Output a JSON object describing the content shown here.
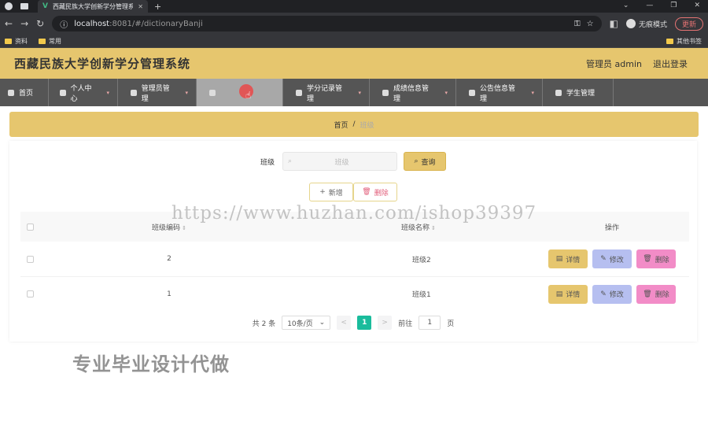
{
  "browser": {
    "tab_title": "西藏民族大学创新学分管理系统",
    "url_host": "localhost",
    "url_path": ":8081/#/dictionaryBanji",
    "incognito_label": "无痕模式",
    "update_label": "更新",
    "bookmarks": [
      "资料",
      "常用"
    ],
    "bookmarks_right": "其他书签"
  },
  "header": {
    "title": "西藏民族大学创新学分管理系统",
    "user_label": "管理员 admin",
    "logout_label": "退出登录"
  },
  "menu": [
    {
      "label": "首页",
      "icon": "home-icon"
    },
    {
      "label": "个人中心",
      "icon": "user-icon"
    },
    {
      "label": "管理员管理",
      "icon": "grid-icon"
    },
    {
      "label": "",
      "icon": "clock-icon",
      "active": true
    },
    {
      "label": "学分记录管理",
      "icon": "pin-icon"
    },
    {
      "label": "成绩信息管理",
      "icon": "camera-icon"
    },
    {
      "label": "公告信息管理",
      "icon": "copy-icon"
    },
    {
      "label": "学生管理",
      "icon": "user-icon"
    }
  ],
  "breadcrumb": {
    "home": "首页",
    "sep": "/",
    "current": "班级"
  },
  "search": {
    "label": "班级",
    "placeholder": "班级",
    "query_button": "查询"
  },
  "actions": {
    "add": "新增",
    "delete": "删除"
  },
  "table": {
    "columns": {
      "code": "班级编码",
      "name": "班级名称",
      "ops": "操作"
    },
    "rows": [
      {
        "code": "2",
        "name": "班级2"
      },
      {
        "code": "1",
        "name": "班级1"
      }
    ],
    "op_labels": {
      "detail": "详情",
      "edit": "修改",
      "delete": "删除"
    }
  },
  "pager": {
    "total": "共 2 条",
    "page_size": "10条/页",
    "prev": "<",
    "current": "1",
    "next": ">",
    "goto_label": "前往",
    "goto_value": "1",
    "page_unit": "页"
  },
  "watermarks": {
    "url": "https://www.huzhan.com/ishop39397",
    "cn": "专业毕业设计代做"
  },
  "colors": {
    "accent": "#e6c66e",
    "menu_bg": "#555555",
    "edit": "#b6bff0",
    "delete": "#f28cc7",
    "pager_active": "#1abc9c"
  }
}
